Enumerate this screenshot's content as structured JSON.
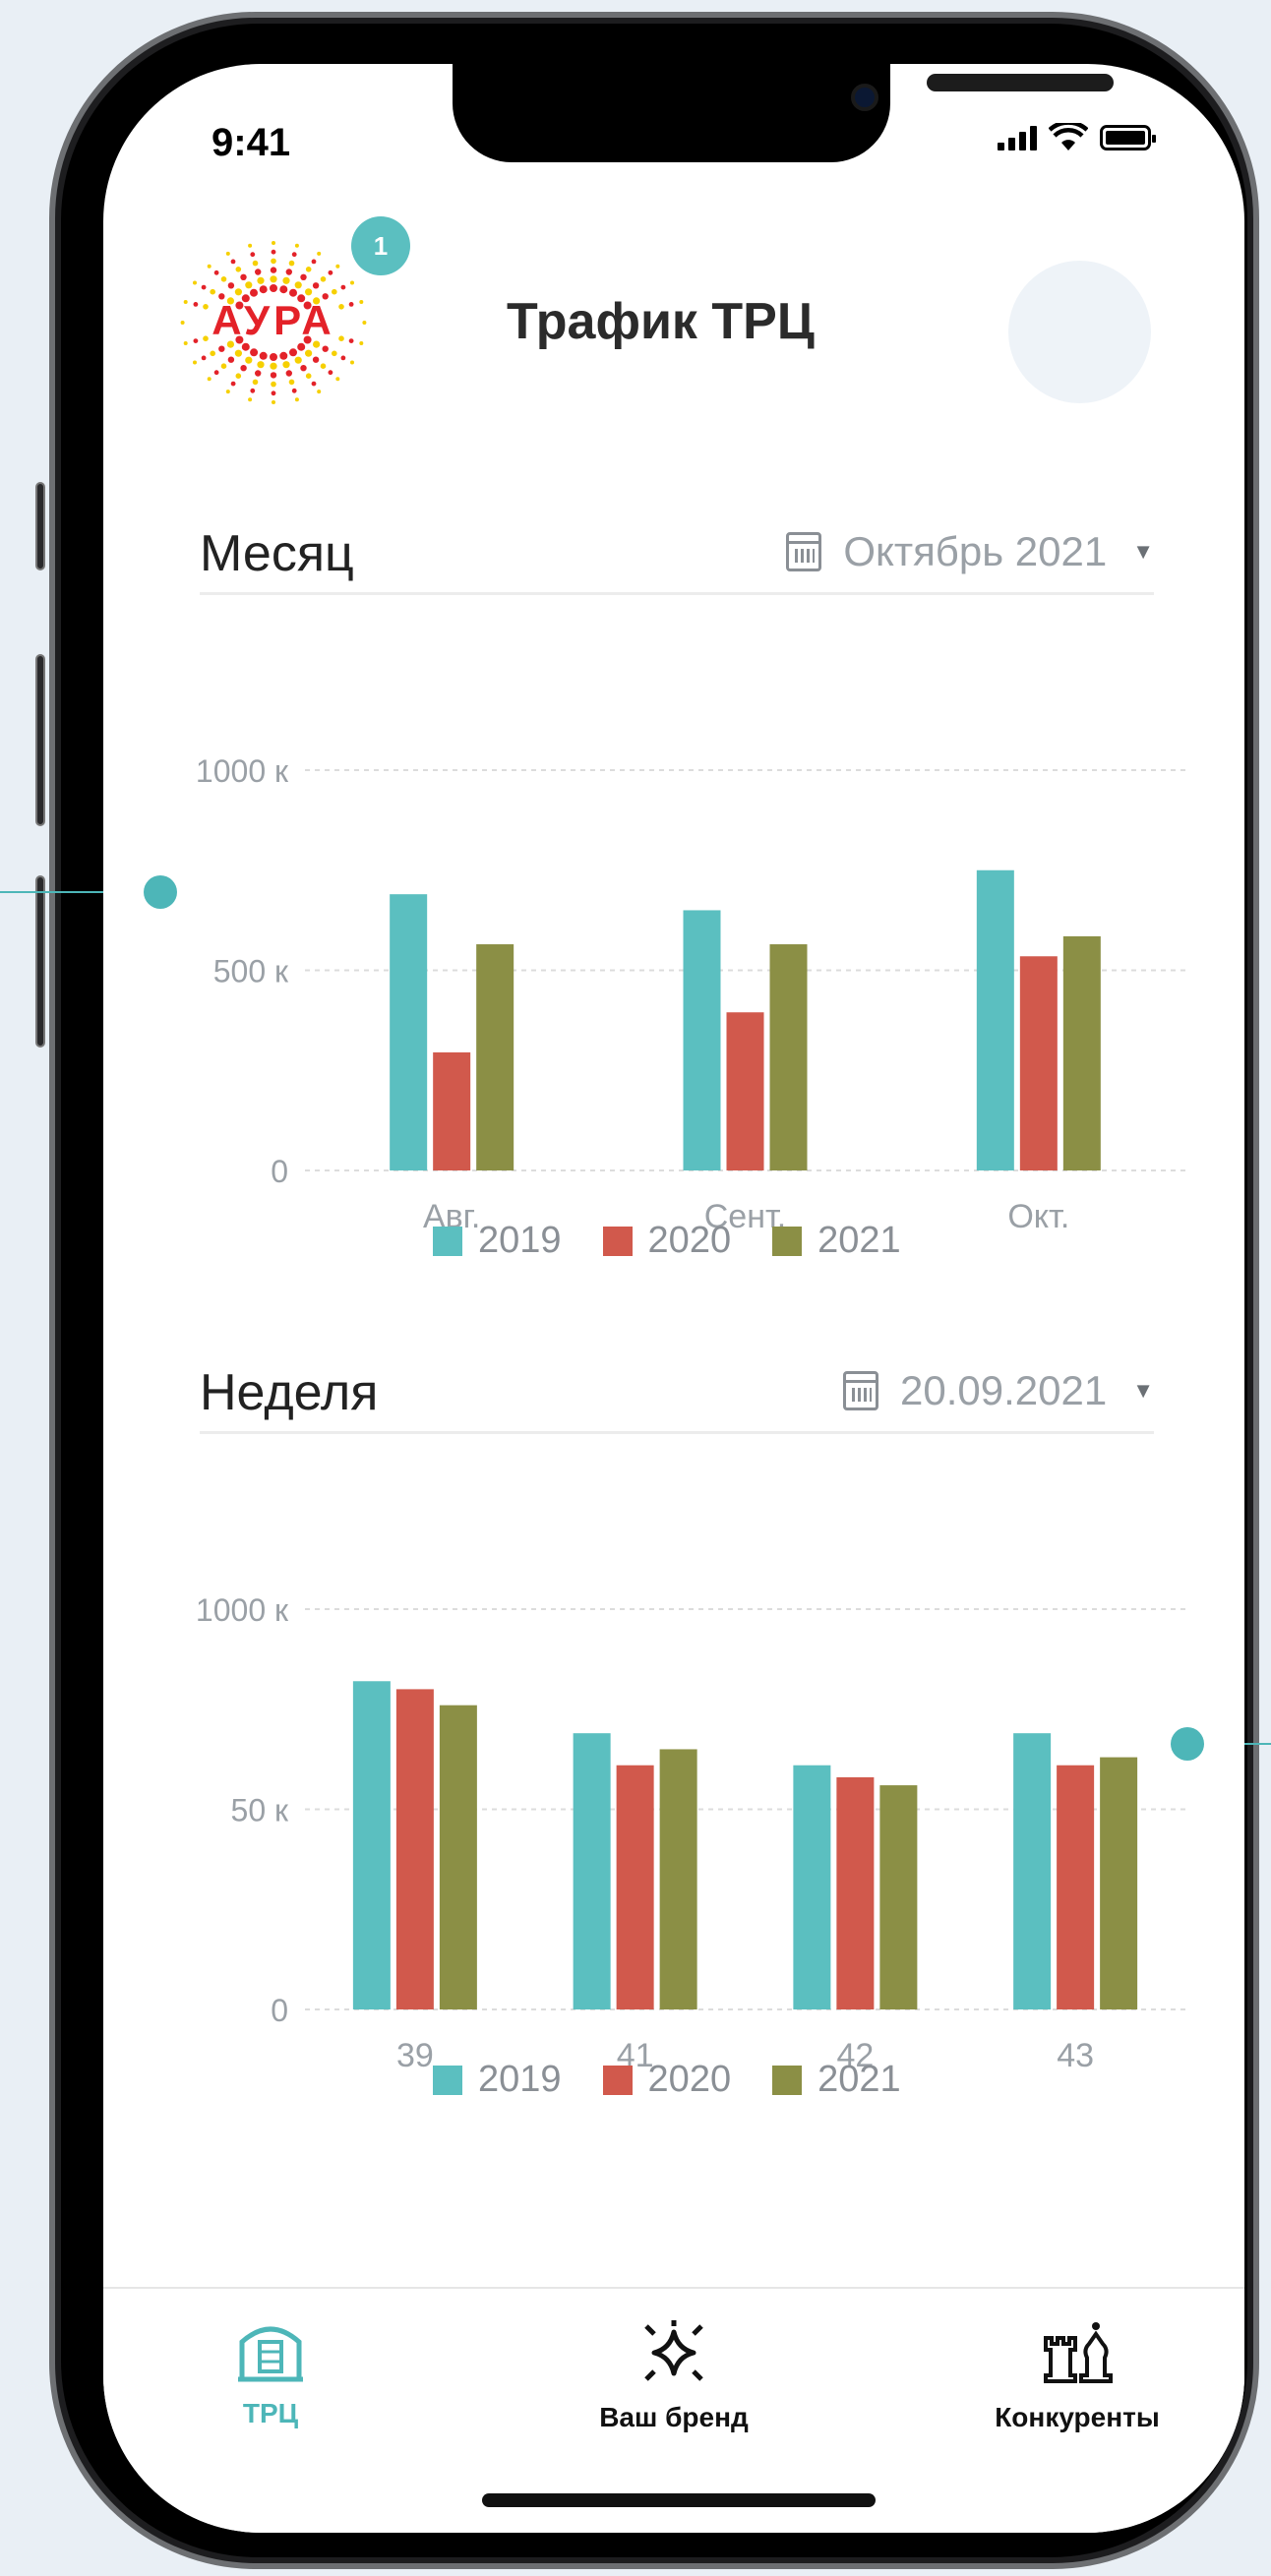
{
  "status": {
    "time": "9:41"
  },
  "header": {
    "title": "Трафик ТРЦ",
    "badge": "1",
    "logo_text": "АУРА"
  },
  "month": {
    "title": "Месяц",
    "picker": "Октябрь 2021",
    "y_ticks": [
      "1000 к",
      "500 к",
      "0"
    ],
    "legend": [
      "2019",
      "2020",
      "2021"
    ]
  },
  "week": {
    "title": "Неделя",
    "picker": "20.09.2021",
    "y_ticks": [
      "1000 к",
      "50 к",
      "0"
    ],
    "legend": [
      "2019",
      "2020",
      "2021"
    ]
  },
  "colors": {
    "y2019": "#5bbfc0",
    "y2020": "#d1594c",
    "y2021": "#8b8f45",
    "accent": "#4db6b8"
  },
  "chart_data": [
    {
      "type": "bar",
      "categories": [
        "Авг.",
        "Сент.",
        "Окт."
      ],
      "series": [
        {
          "name": "2019",
          "values": [
            690,
            650,
            750
          ]
        },
        {
          "name": "2020",
          "values": [
            295,
            395,
            535
          ]
        },
        {
          "name": "2021",
          "values": [
            565,
            565,
            585
          ]
        }
      ],
      "ylim": [
        0,
        1000
      ]
    },
    {
      "type": "bar",
      "categories": [
        "39",
        "41",
        "42",
        "43"
      ],
      "series": [
        {
          "name": "2019",
          "values": [
            82,
            69,
            61,
            69
          ]
        },
        {
          "name": "2020",
          "values": [
            80,
            61,
            58,
            61
          ]
        },
        {
          "name": "2021",
          "values": [
            76,
            65,
            56,
            63
          ]
        }
      ],
      "ylim": [
        0,
        100
      ]
    }
  ],
  "tabs": [
    {
      "label": "ТРЦ",
      "icon": "mall-icon"
    },
    {
      "label": "Ваш бренд",
      "icon": "sparkle-icon"
    },
    {
      "label": "Конкуренты",
      "icon": "chess-icon"
    }
  ]
}
